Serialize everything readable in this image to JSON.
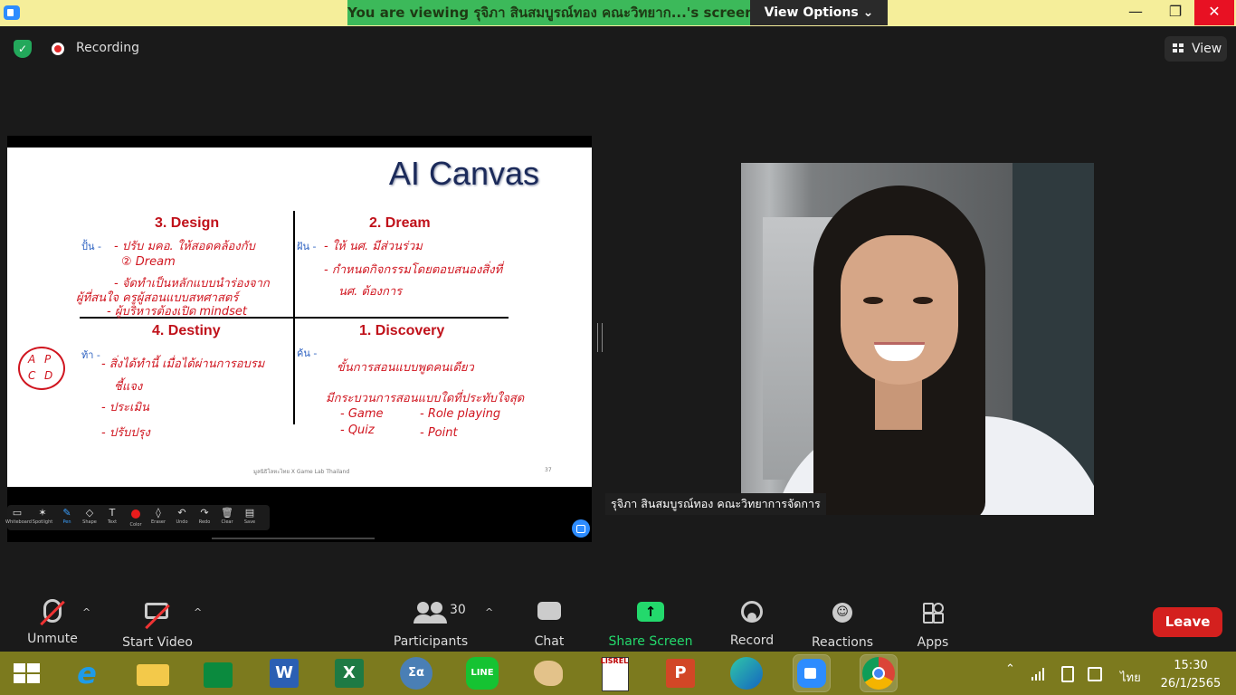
{
  "window": {
    "banner": "You are viewing รุจิภา สินสมบูรณ์ทอง คณะวิทยาก...'s screen",
    "view_options": "View Options ⌄",
    "minimize": "—",
    "maximize": "❐",
    "close": "✕"
  },
  "status": {
    "recording_label": "Recording",
    "view_label": "View"
  },
  "slide": {
    "title": "AI Canvas",
    "q_design": "3. Design",
    "q_dream": "2. Dream",
    "q_destiny": "4. Destiny",
    "q_discovery": "1. Discovery",
    "tag_design": "ปั้น -",
    "tag_dream": "ฝัน -",
    "tag_destiny": "ท้า -",
    "tag_discovery": "ค้น -",
    "hw_design_1": "- ปรับ มคอ. ให้สอดคล้องกับ",
    "hw_design_2": "② Dream",
    "hw_design_3": "- จัดทำเป็นหลักแบบนำร่องจาก",
    "hw_design_4": "ผู้ที่สนใจ ครูผู้สอนแบบสหศาสตร์",
    "hw_design_5": "- ผู้บริหารต้องเปิด mindset",
    "hw_dream_1": "- ให้ นศ. มีส่วนร่วม",
    "hw_dream_2": "- กำหนดกิจกรรมโดยตอบสนองสิ่งที่",
    "hw_dream_3": "นศ. ต้องการ",
    "hw_destiny_1": "- สิ่งได้ทำนี้ เมื่อได้ผ่านการอบรม",
    "hw_destiny_2": "ชี้แจง",
    "hw_destiny_3": "- ประเมิน",
    "hw_destiny_4": "- ปรับปรุง",
    "hw_discovery_1": "ขั้นการสอนแบบพูดคนเดียว",
    "hw_discovery_2": "มีกระบวนการสอนแบบใดที่ประทับใจสุด",
    "hw_discovery_3": "- Game",
    "hw_discovery_4": "- Role playing",
    "hw_discovery_5": "- Quiz",
    "hw_discovery_6": "- Point",
    "apcd_a": "A",
    "apcd_p": "P",
    "apcd_c": "C",
    "apcd_d": "D",
    "footer": "มูลนิธิโลหะไทย X Game Lab Thailand",
    "page_no": "37"
  },
  "annotate": {
    "tools": [
      {
        "glyph": "▭",
        "label": "Whiteboard"
      },
      {
        "glyph": "✶",
        "label": "Spotlight"
      },
      {
        "glyph": "✎",
        "label": "Pen",
        "active": true
      },
      {
        "glyph": "◇",
        "label": "Shape"
      },
      {
        "glyph": "T",
        "label": "Text"
      },
      {
        "glyph": "",
        "label": "Color"
      },
      {
        "glyph": "◊",
        "label": "Eraser"
      },
      {
        "glyph": "↶",
        "label": "Undo"
      },
      {
        "glyph": "↷",
        "label": "Redo"
      },
      {
        "glyph": "🗑",
        "label": "Clear"
      },
      {
        "glyph": "▤",
        "label": "Save"
      }
    ],
    "pen_color": "#e81c1c"
  },
  "participant": {
    "name": "รุจิภา สินสมบูรณ์ทอง คณะวิทยาการจัดการ"
  },
  "toolbar": {
    "unmute": "Unmute",
    "start_video": "Start Video",
    "participants": "Participants",
    "participant_count": "30",
    "chat": "Chat",
    "share_screen": "Share Screen",
    "record": "Record",
    "reactions": "Reactions",
    "apps": "Apps",
    "leave": "Leave",
    "caret": "^",
    "share_arrow": "↑",
    "reaction_face": "☺",
    "shield_check": "✓"
  },
  "taskbar": {
    "apps": [
      "windows-start",
      "internet-explorer",
      "file-explorer",
      "microsoft-store",
      "word",
      "excel",
      "calculator",
      "line",
      "paint",
      "lisrel",
      "powerpoint",
      "edge",
      "zoom",
      "chrome"
    ],
    "word_letter": "W",
    "excel_letter": "X",
    "powerpoint_letter": "P",
    "line_text": "LINE",
    "lisrel_text": "LISREL",
    "ie_letter": "e",
    "calc_symbol": "Σα",
    "tray_chevron": "⌃",
    "language": "ไทย",
    "time": "15:30",
    "date": "26/1/2565"
  }
}
